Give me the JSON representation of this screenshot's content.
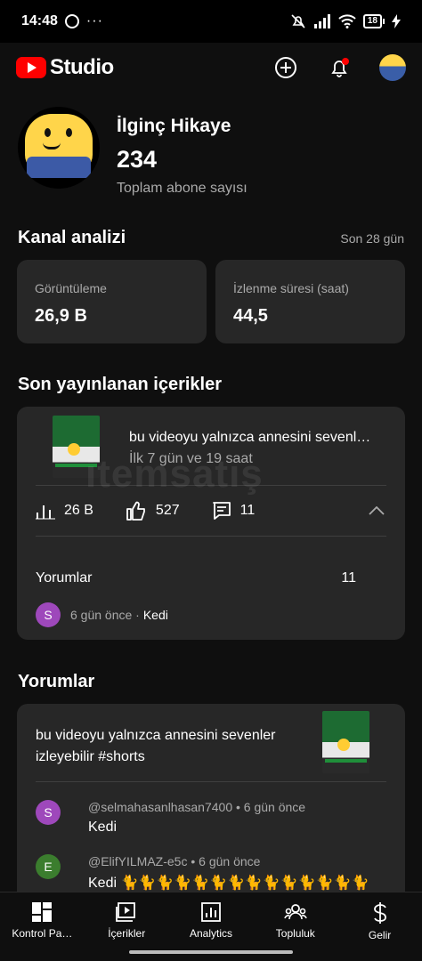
{
  "status_bar": {
    "time": "14:48",
    "battery": "18",
    "more": "···"
  },
  "app": {
    "brand": "Studio"
  },
  "channel": {
    "name": "İlginç Hikaye",
    "subscribers": "234",
    "subscribers_label": "Toplam abone sayısı"
  },
  "analytics": {
    "title": "Kanal analizi",
    "period": "Son 28 gün",
    "metrics": [
      {
        "label": "Görüntüleme",
        "value": "26,9 B"
      },
      {
        "label": "İzlenme süresi (saat)",
        "value": "44,5"
      }
    ]
  },
  "latest": {
    "title": "Son yayınlanan içerikler",
    "video_title": "bu videoyu yalnızca annesini sevenl…",
    "video_sub": "İlk 7 gün ve 19 saat",
    "views": "26 B",
    "likes": "527",
    "comments": "11",
    "comments_label": "Yorumlar",
    "comments_count": "11",
    "recent_avatar": "S",
    "recent_time": "6 gün önce ·",
    "recent_text": "Kedi"
  },
  "comments_section": {
    "title": "Yorumlar",
    "video_title": "bu videoyu yalnızca annesini sevenler izleyebilir #shorts",
    "items": [
      {
        "avatar": "S",
        "author_meta": "@selmahasanlhasan7400 • 6 gün önce",
        "text": "Kedi"
      },
      {
        "avatar": "E",
        "author_meta": "@ElifYILMAZ-e5c • 6 gün önce",
        "text": "Kedi 🐈🐈🐈🐈🐈🐈🐈🐈🐈🐈🐈🐈🐈🐈"
      }
    ]
  },
  "watermark": "itemsatış",
  "bottom_nav": [
    {
      "label": "Kontrol Pa…"
    },
    {
      "label": "İçerikler"
    },
    {
      "label": "Analytics"
    },
    {
      "label": "Topluluk"
    },
    {
      "label": "Gelir"
    }
  ],
  "colors": {
    "background": "#0f0f0f",
    "card": "#272727",
    "brand_red": "#ff0000",
    "notification_dot": "#ff0000"
  }
}
